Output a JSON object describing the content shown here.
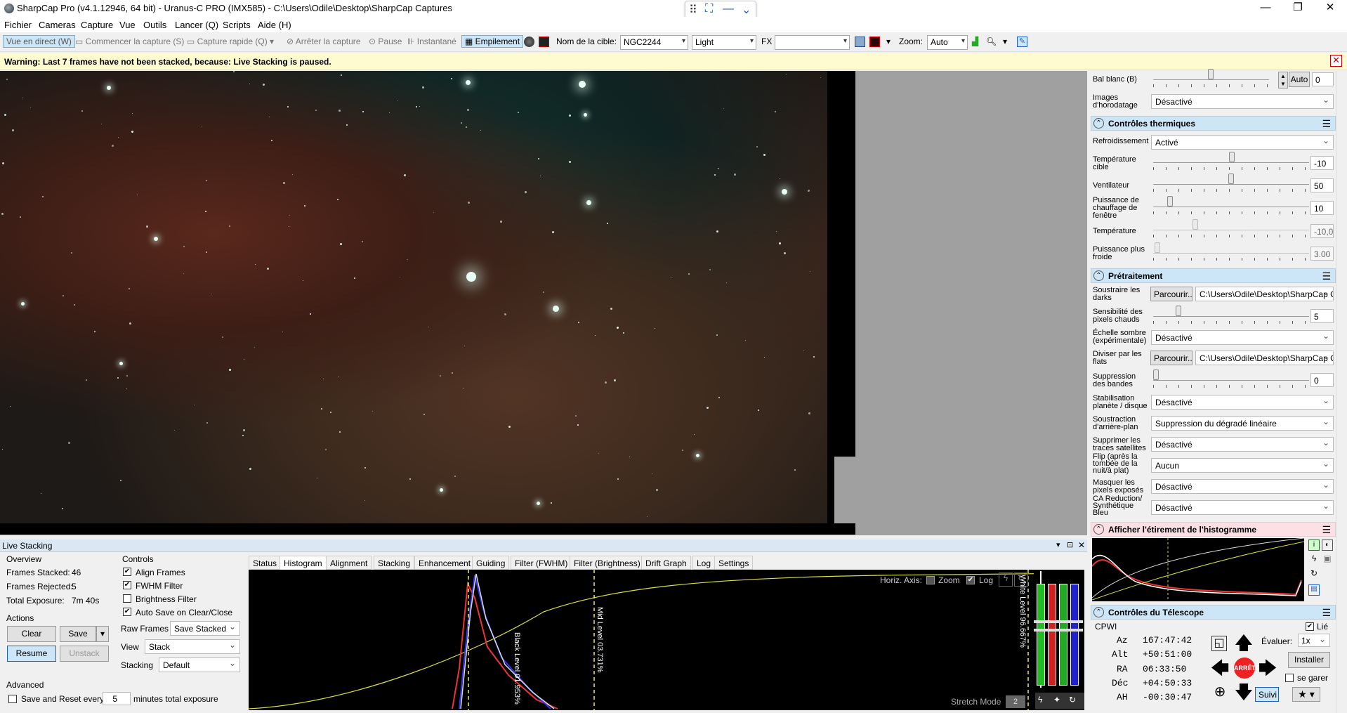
{
  "window": {
    "title": "SharpCap Pro (v4.1.12946, 64 bit) - Uranus-C PRO (IMX585) - C:\\Users\\Odile\\Desktop\\SharpCap Captures",
    "minimize": "—",
    "maximize": "❐",
    "close": "✕"
  },
  "menu": [
    "Fichier",
    "Cameras",
    "Capture",
    "Vue",
    "Outils",
    "Lancer (Q)",
    "Scripts",
    "Aide (H)"
  ],
  "toolbar": {
    "live_view": "Vue en direct (W)",
    "start_capture": "Commencer la capture (S)",
    "quick_capture": "Capture rapide (Q)",
    "stop_capture": "Arrêter la capture",
    "pause": "Pause",
    "snapshot": "Instantané",
    "stacking": "Empilement",
    "target_label": "Nom de la cible:",
    "target_value": "NGC2244",
    "frame_type": "Light",
    "fx_label": "FX",
    "fx_value": "",
    "zoom_label": "Zoom:",
    "zoom_value": "Auto"
  },
  "warning": "Warning: Last 7 frames have not been stacked, because: Live Stacking is paused.",
  "right_panel": {
    "white_bal": {
      "label": "Bal blanc (B)",
      "auto": "Auto",
      "value": "0",
      "level": 0.4
    },
    "timestamp": {
      "label1": "Images",
      "label2": "d'horodatage",
      "value": "Désactivé"
    },
    "thermal_header": "Contrôles thermiques",
    "cooling": {
      "label": "Refroidissement",
      "value": "Activé"
    },
    "target_temp": {
      "label1": "Température",
      "label2": "cible",
      "value": "-10",
      "level": 0.5
    },
    "fan": {
      "label": "Ventilateur",
      "value": "50",
      "level": 0.5
    },
    "heater": {
      "label1": "Puissance de",
      "label2": "chauffage de",
      "label3": "fenêtre",
      "value": "10",
      "level": 0.1
    },
    "temperature": {
      "label": "Température",
      "value": "-10,0",
      "level": 0.3
    },
    "cooler_power": {
      "label1": "Puissance plus",
      "label2": "froide",
      "value": "3.00",
      "level": 0.03
    },
    "preproc_header": "Prétraitement",
    "darks": {
      "label1": "Soustraire les",
      "label2": "darks",
      "browse": "Parcourir...",
      "path": "C:\\Users\\Odile\\Desktop\\SharpCap Captures"
    },
    "hot_pixel": {
      "label1": "Sensibilité des",
      "label2": "pixels chauds",
      "value": "5",
      "level": 0.15
    },
    "dark_scale": {
      "label1": "Échelle sombre",
      "label2": "(expérimentale)",
      "value": "Désactivé"
    },
    "flats": {
      "label1": "Diviser par les",
      "label2": "flats",
      "browse": "Parcourir...",
      "path": "C:\\Users\\Odile\\Desktop\\SharpCap Captures"
    },
    "banding": {
      "label1": "Suppression",
      "label2": "des bandes",
      "value": "0",
      "level": 0
    },
    "stabilization": {
      "label1": "Stabilisation",
      "label2": "planète / disque",
      "value": "Désactivé"
    },
    "bg_sub": {
      "label1": "Soustraction",
      "label2": "d'arrière-plan",
      "value": "Suppression du dégradé linéaire"
    },
    "sat_trails": {
      "label1": "Supprimer les",
      "label2": "traces satellites",
      "value": "Désactivé"
    },
    "flip": {
      "label1": "Flip (après la",
      "label2": "tombée de la",
      "label3": "nuit/à plat)",
      "value": "Aucun"
    },
    "mask_exposed": {
      "label1": "Masquer les",
      "label2": "pixels exposés",
      "value": "Désactivé"
    },
    "ca_reduction": {
      "label1": "CA Reduction/",
      "label2": "Synthétique",
      "label3": "Bleu",
      "value": "Désactivé"
    },
    "histo_header": "Afficher l'étirement de l'histogramme",
    "telescope_header": "Contrôles du Télescope",
    "telescope": {
      "mount": "CPWI",
      "linked": "Lié",
      "az_label": "Az",
      "az": "167:47:42",
      "alt_label": "Alt",
      "alt": "+50:51:00",
      "ra_label": "RA",
      "ra": "06:33:50",
      "dec_label": "Déc",
      "dec": "+04:50:33",
      "ah_label": "AH",
      "ah": "-00:30:47",
      "speed_label": "Évaluer:",
      "speed": "1x",
      "install": "Installer",
      "stop": "ARRÊTE",
      "park": "se garer",
      "track": "Suivi"
    }
  },
  "live_stacking": {
    "title": "Live Stacking",
    "overview_label": "Overview",
    "stacked_label": "Frames Stacked:",
    "stacked": "46",
    "rejected_label": "Frames Rejected:",
    "rejected": "5",
    "exposure_label": "Total Exposure:",
    "exposure": "7m 40s",
    "actions_label": "Actions",
    "clear": "Clear",
    "save": "Save",
    "resume": "Resume",
    "unstack": "Unstack",
    "controls_label": "Controls",
    "align": "Align Frames",
    "fwhm": "FWHM Filter",
    "brightness": "Brightness Filter",
    "autosave": "Auto Save on Clear/Close",
    "raw_frames_label": "Raw Frames",
    "raw_frames": "Save Stacked",
    "view_label": "View",
    "view": "Stack",
    "stacking_label": "Stacking",
    "stacking": "Default",
    "advanced_label": "Advanced",
    "save_reset": "Save and Reset every",
    "save_reset_value": "5",
    "save_reset_unit": "minutes total exposure",
    "tabs": [
      "Status",
      "Histogram",
      "Alignment",
      "Stacking",
      "Enhancement",
      "Guiding",
      "Filter (FWHM)",
      "Filter (Brightness)",
      "Drift Graph",
      "Log",
      "Settings"
    ],
    "active_tab": "Histogram",
    "horiz_axis": "Horiz. Axis:",
    "zoom": "Zoom",
    "log": "Log",
    "black_level": "Black Level 01.953%",
    "mid_level": "Mid Level 03.731%",
    "white_level": "White Level 96.667%",
    "stretch_mode": "Stretch Mode",
    "stretch_value": "2"
  },
  "colors": {
    "accent": "#1f5fbf",
    "section_header": "#cde6f7",
    "warning_bg": "#fffbd1",
    "histo_header": "#fde0e6"
  }
}
